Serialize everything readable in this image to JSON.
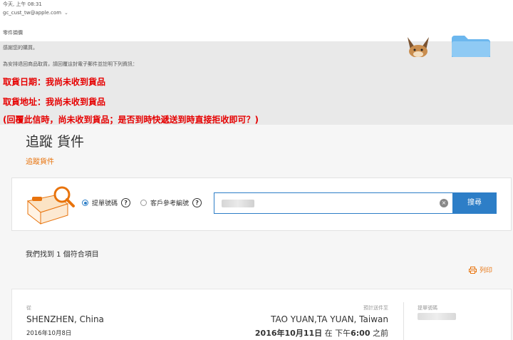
{
  "email": {
    "time": "今天, 上午 08:31",
    "sender": "gc_cust_tw@apple.com",
    "subject": "零件擷價",
    "thanks": "感謝您的購買。",
    "instructions": "為安排退回商品取貨，請回覆這封電子郵件並註明下列資訊：",
    "pickup_date": "取貨日期：我尚未收到貨品",
    "pickup_address": "取貨地址：我尚未收到貨品",
    "question": "(回覆此信時，尚未收到貨品；是否到時快遞送到時直接拒收即可？)"
  },
  "tracking": {
    "title": "追蹤 貨件",
    "breadcrumb": "追蹤貨件",
    "radio_waybill": "提單號碼",
    "radio_reference": "客戶參考編號",
    "help_glyph": "?",
    "clear_glyph": "×",
    "search_button": "搜尋",
    "result_count": "我們找到 1 個符合項目",
    "print_label": "列印"
  },
  "result": {
    "from_label": "從",
    "from_city": "SHENZHEN, China",
    "from_date": "2016年10月8日",
    "eta_label": "預計送件至",
    "to_city": "TAO YUAN,TA YUAN, Taiwan",
    "to_date_bold1": "2016年10月11日",
    "to_date_mid": " 在 下午",
    "to_date_time": "6:00",
    "to_date_end": " 之前",
    "tracking_label": "提單號碼"
  },
  "colors": {
    "accent": "#2d7ec7",
    "orange": "#e8730c",
    "alert_red": "#e60000"
  }
}
